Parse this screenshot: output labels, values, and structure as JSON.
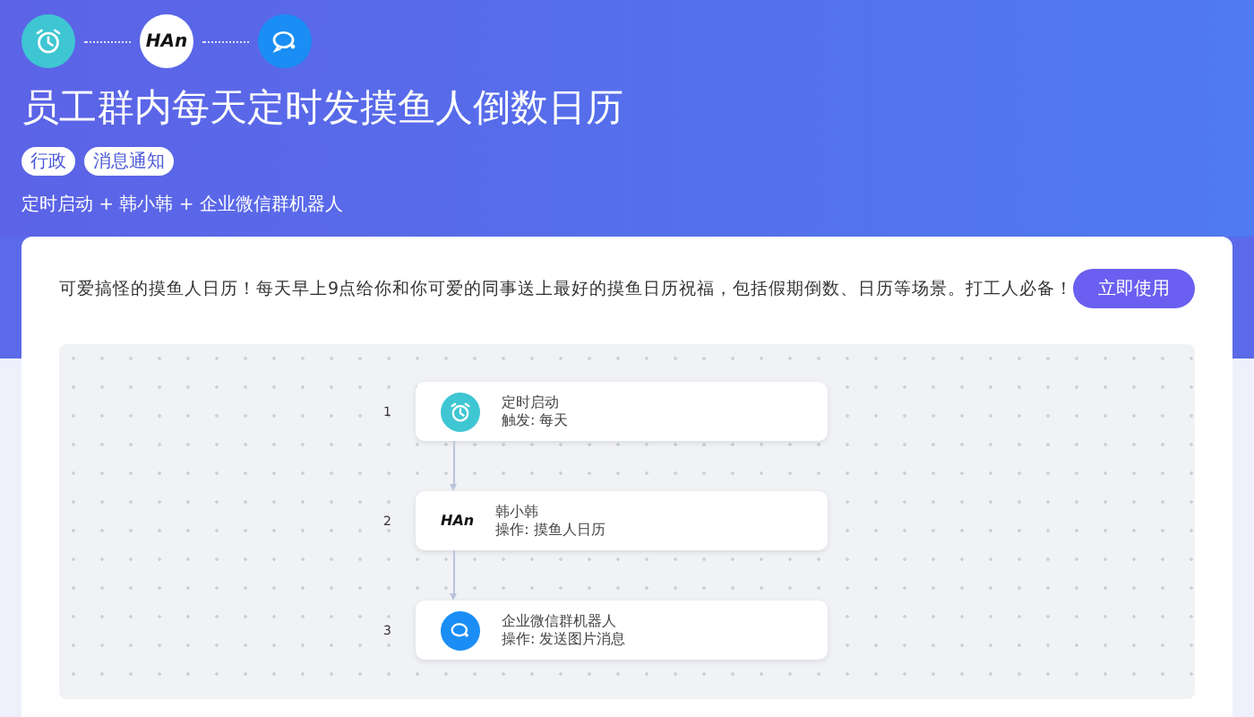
{
  "header": {
    "flow_icons": [
      {
        "kind": "clock"
      },
      {
        "kind": "logo",
        "text": "HAn"
      },
      {
        "kind": "chat"
      }
    ],
    "title": "员工群内每天定时发摸鱼人倒数日历",
    "tags": [
      "行政",
      "消息通知"
    ],
    "apps": "定时启动 + 韩小韩 + 企业微信群机器人"
  },
  "card": {
    "description": "可爱搞怪的摸鱼人日历！每天早上9点给你和你可爱的同事送上最好的摸鱼日历祝福，包括假期倒数、日历等场景。打工人必备！",
    "use_button": "立即使用",
    "steps": [
      {
        "number": "1",
        "kind": "clock",
        "name": "定时启动",
        "detail": "触发: 每天"
      },
      {
        "number": "2",
        "kind": "logo",
        "logo_text": "HAn",
        "name": "韩小韩",
        "detail": "操作: 摸鱼人日历"
      },
      {
        "number": "3",
        "kind": "chat",
        "name": "企业微信群机器人",
        "detail": "操作: 发送图片消息"
      }
    ]
  }
}
